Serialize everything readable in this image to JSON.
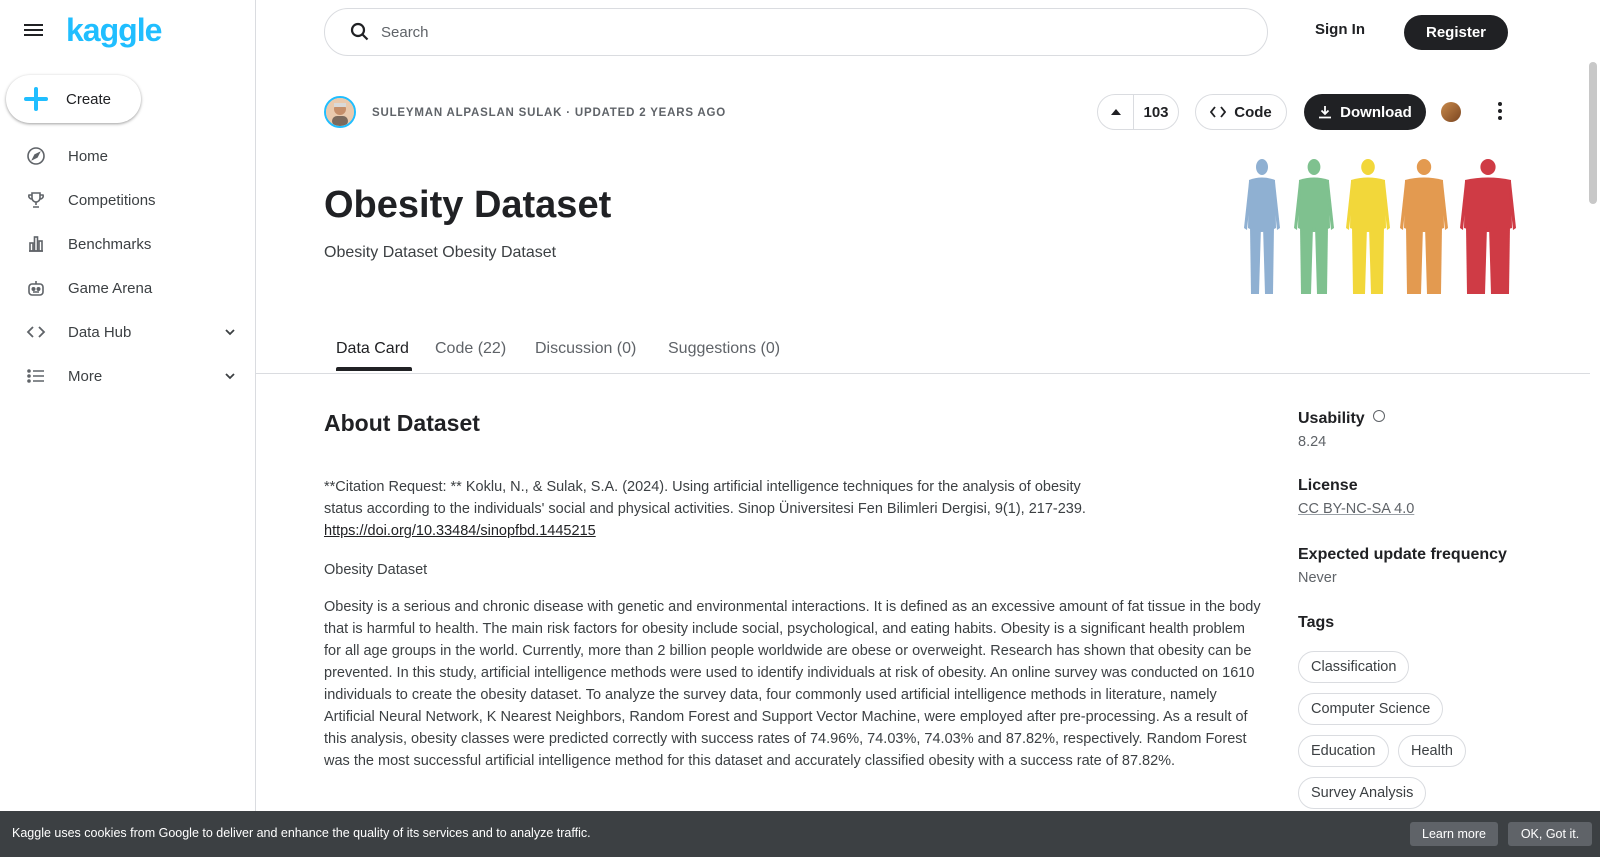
{
  "brand": {
    "logo": "kaggle",
    "accent": "#20beff"
  },
  "sidebar": {
    "create_label": "Create",
    "items": [
      {
        "label": "Home",
        "icon": "compass-icon"
      },
      {
        "label": "Competitions",
        "icon": "trophy-icon"
      },
      {
        "label": "Benchmarks",
        "icon": "bar-chart-icon"
      },
      {
        "label": "Game Arena",
        "icon": "robot-icon"
      },
      {
        "label": "Data Hub",
        "icon": "code-brackets-icon",
        "expandable": true
      },
      {
        "label": "More",
        "icon": "list-icon",
        "expandable": true
      }
    ]
  },
  "topbar": {
    "search_placeholder": "Search",
    "sign_in": "Sign In",
    "register": "Register"
  },
  "dataset": {
    "byline": "SULEYMAN ALPASLAN SULAK · UPDATED 2 YEARS AGO",
    "votes": "103",
    "code_label": "Code",
    "download_label": "Download",
    "title": "Obesity Dataset",
    "subtitle": "Obesity Dataset Obesity Dataset"
  },
  "tabs": [
    {
      "label": "Data Card",
      "active": true
    },
    {
      "label": "Code (22)"
    },
    {
      "label": "Discussion (0)"
    },
    {
      "label": "Suggestions (0)"
    }
  ],
  "about": {
    "heading": "About Dataset",
    "citation_text": "**Citation Request: ** Koklu, N., & Sulak, S.A. (2024). Using artificial intelligence techniques for the analysis of obesity status according to the individuals' social and physical activities. Sinop Üniversitesi Fen Bilimleri Dergisi, 9(1), 217-239.",
    "citation_link": "https://doi.org/10.33484/sinopfbd.1445215",
    "para2": "Obesity Dataset",
    "para3": "Obesity is a serious and chronic disease with genetic and environmental interactions. It is defined as an excessive amount of fat tissue in the body that is harmful to health. The main risk factors for obesity include social, psychological, and eating habits. Obesity is a significant health problem for all age groups in the world. Currently, more than 2 billion people worldwide are obese or overweight. Research has shown that obesity can be prevented. In this study, artificial intelligence methods were used to identify individuals at risk of obesity. An online survey was conducted on 1610 individuals to create the obesity dataset. To analyze the survey data, four commonly used artificial intelligence methods in literature, namely Artificial Neural Network, K Nearest Neighbors, Random Forest and Support Vector Machine, were employed after pre-processing. As a result of this analysis, obesity classes were predicted correctly with success rates of 74.96%, 74.03%, 74.03% and 87.82%, respectively. Random Forest was the most successful artificial intelligence method for this dataset and accurately classified obesity with a success rate of 87.82%."
  },
  "meta": {
    "usability_label": "Usability",
    "usability_value": "8.24",
    "license_label": "License",
    "license_value": "CC BY-NC-SA 4.0",
    "update_label": "Expected update frequency",
    "update_value": "Never",
    "tags_label": "Tags",
    "tags": [
      "Classification",
      "Computer Science",
      "Education",
      "Health",
      "Survey Analysis"
    ]
  },
  "cookie": {
    "text": "Kaggle uses cookies from Google to deliver and enhance the quality of its services and to analyze traffic.",
    "learn_more": "Learn more",
    "ok": "OK, Got it."
  },
  "hero_colors": [
    "#8fb0d2",
    "#7fc18f",
    "#f2d73a",
    "#e39a50",
    "#cf3b45"
  ]
}
